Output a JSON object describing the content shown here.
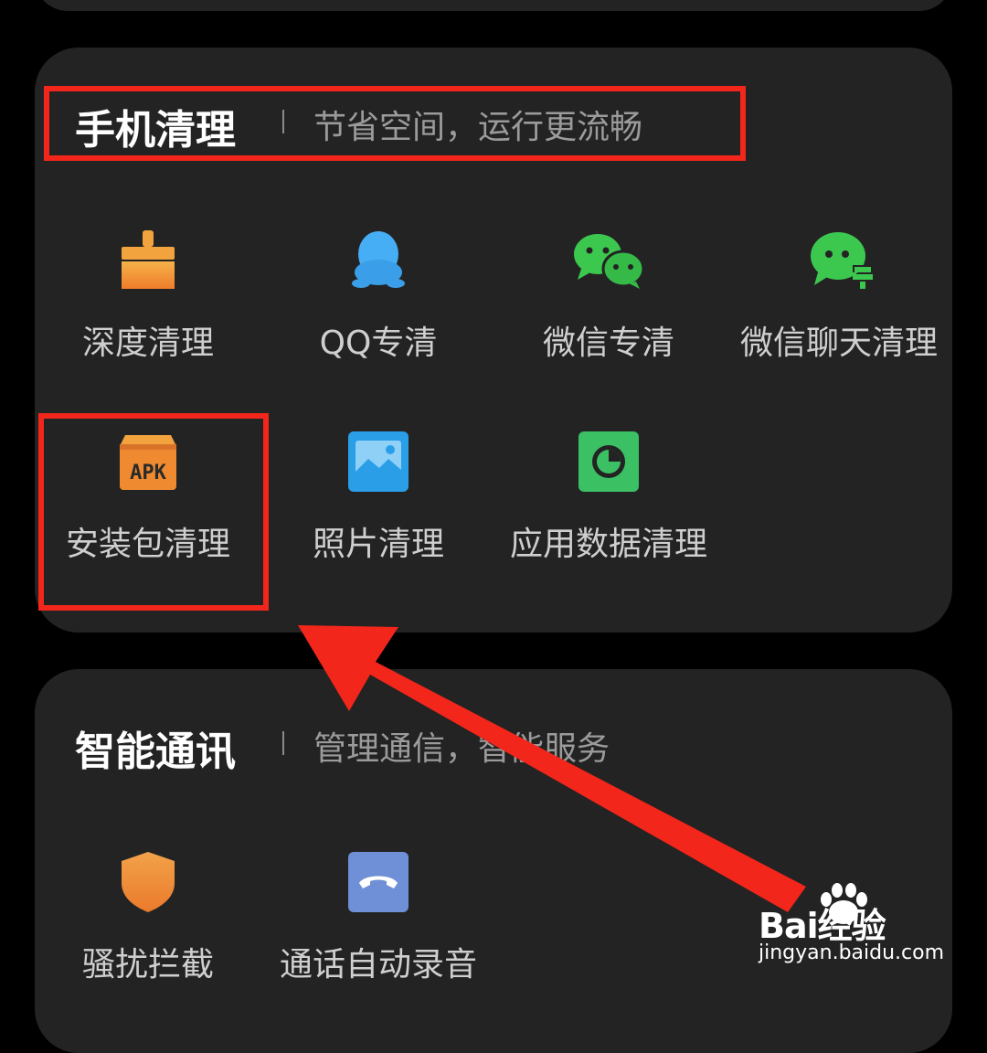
{
  "sections": {
    "clean": {
      "title": "手机清理",
      "subtitle": "节省空间，运行更流畅",
      "items": [
        {
          "label": "深度清理",
          "icon": "broom-icon"
        },
        {
          "label": "QQ专清",
          "icon": "qq-penguin-icon"
        },
        {
          "label": "微信专清",
          "icon": "wechat-icon"
        },
        {
          "label": "微信聊天清理",
          "icon": "wechat-chat-clean-icon"
        },
        {
          "label": "安装包清理",
          "icon": "apk-package-icon"
        },
        {
          "label": "照片清理",
          "icon": "photo-icon"
        },
        {
          "label": "应用数据清理",
          "icon": "app-data-pie-icon"
        }
      ]
    },
    "comm": {
      "title": "智能通讯",
      "subtitle": "管理通信，智能服务",
      "items": [
        {
          "label": "骚扰拦截",
          "icon": "shield-icon"
        },
        {
          "label": "通话自动录音",
          "icon": "call-record-icon"
        }
      ]
    }
  },
  "apk_icon_text": "APK",
  "watermark": {
    "brand": "Bai经验",
    "url": "jingyan.baidu.com"
  },
  "colors": {
    "background": "#000000",
    "card": "#232323",
    "highlight": "#f2261a",
    "orange": "#f09a3a",
    "qq_blue": "#3fa9f5",
    "wechat_green": "#38c24d",
    "photo_blue": "#2b9ee8",
    "app_green": "#3cc064",
    "call_blue": "#6f8fd6"
  }
}
